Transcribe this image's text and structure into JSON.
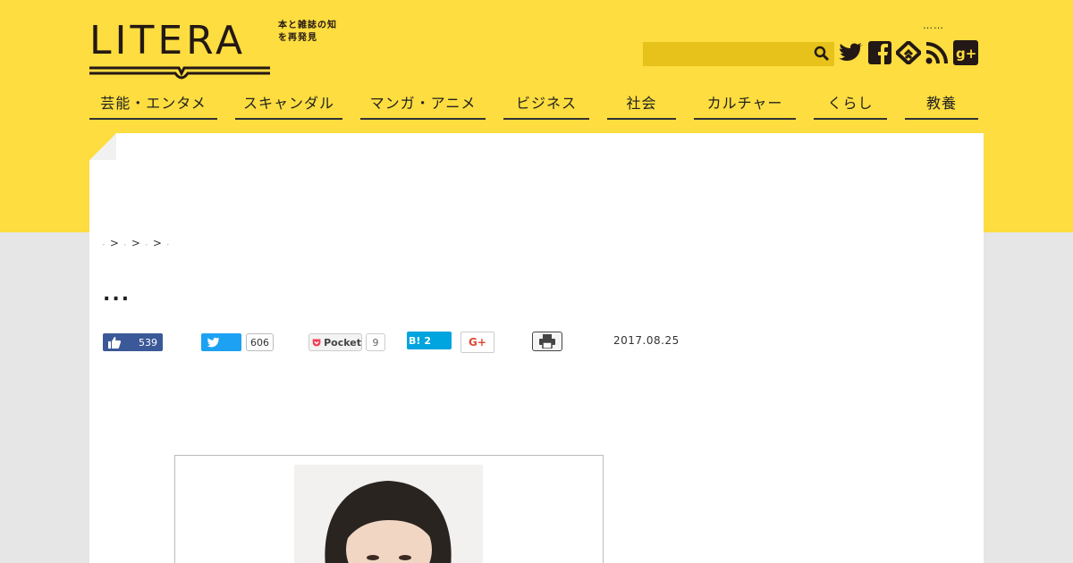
{
  "header": {
    "logo_text": "LITERA",
    "logo_tagline": "本と雑誌の知を再発見",
    "top_links": "……",
    "search_placeholder": ""
  },
  "social_icons": [
    "twitter-icon",
    "facebook-icon",
    "feedly-icon",
    "rss-icon",
    "google-plus-icon"
  ],
  "nav": {
    "items": [
      "芸能・エンタメ",
      "スキャンダル",
      "マンガ・アニメ",
      "ビジネス",
      "社会",
      "カルチャー",
      "くらし",
      "教養"
    ]
  },
  "breadcrumb": {
    "items": [
      ",",
      ",",
      ",",
      ","
    ],
    "separator": ">"
  },
  "article": {
    "title": "...",
    "date": "2017.08.25"
  },
  "share": {
    "facebook_count": "539",
    "twitter_count": "606",
    "pocket_label": "Pocket",
    "pocket_count": "9",
    "hatena_label": "B!",
    "hatena_count": "2",
    "gplus_label": "G+"
  },
  "colors": {
    "brand_yellow": "#fddd3f",
    "search_bg": "#e6c21b",
    "facebook": "#3b5998",
    "twitter": "#1da1f2",
    "hatena": "#00a4de",
    "page_bg": "#e6e6e6"
  }
}
